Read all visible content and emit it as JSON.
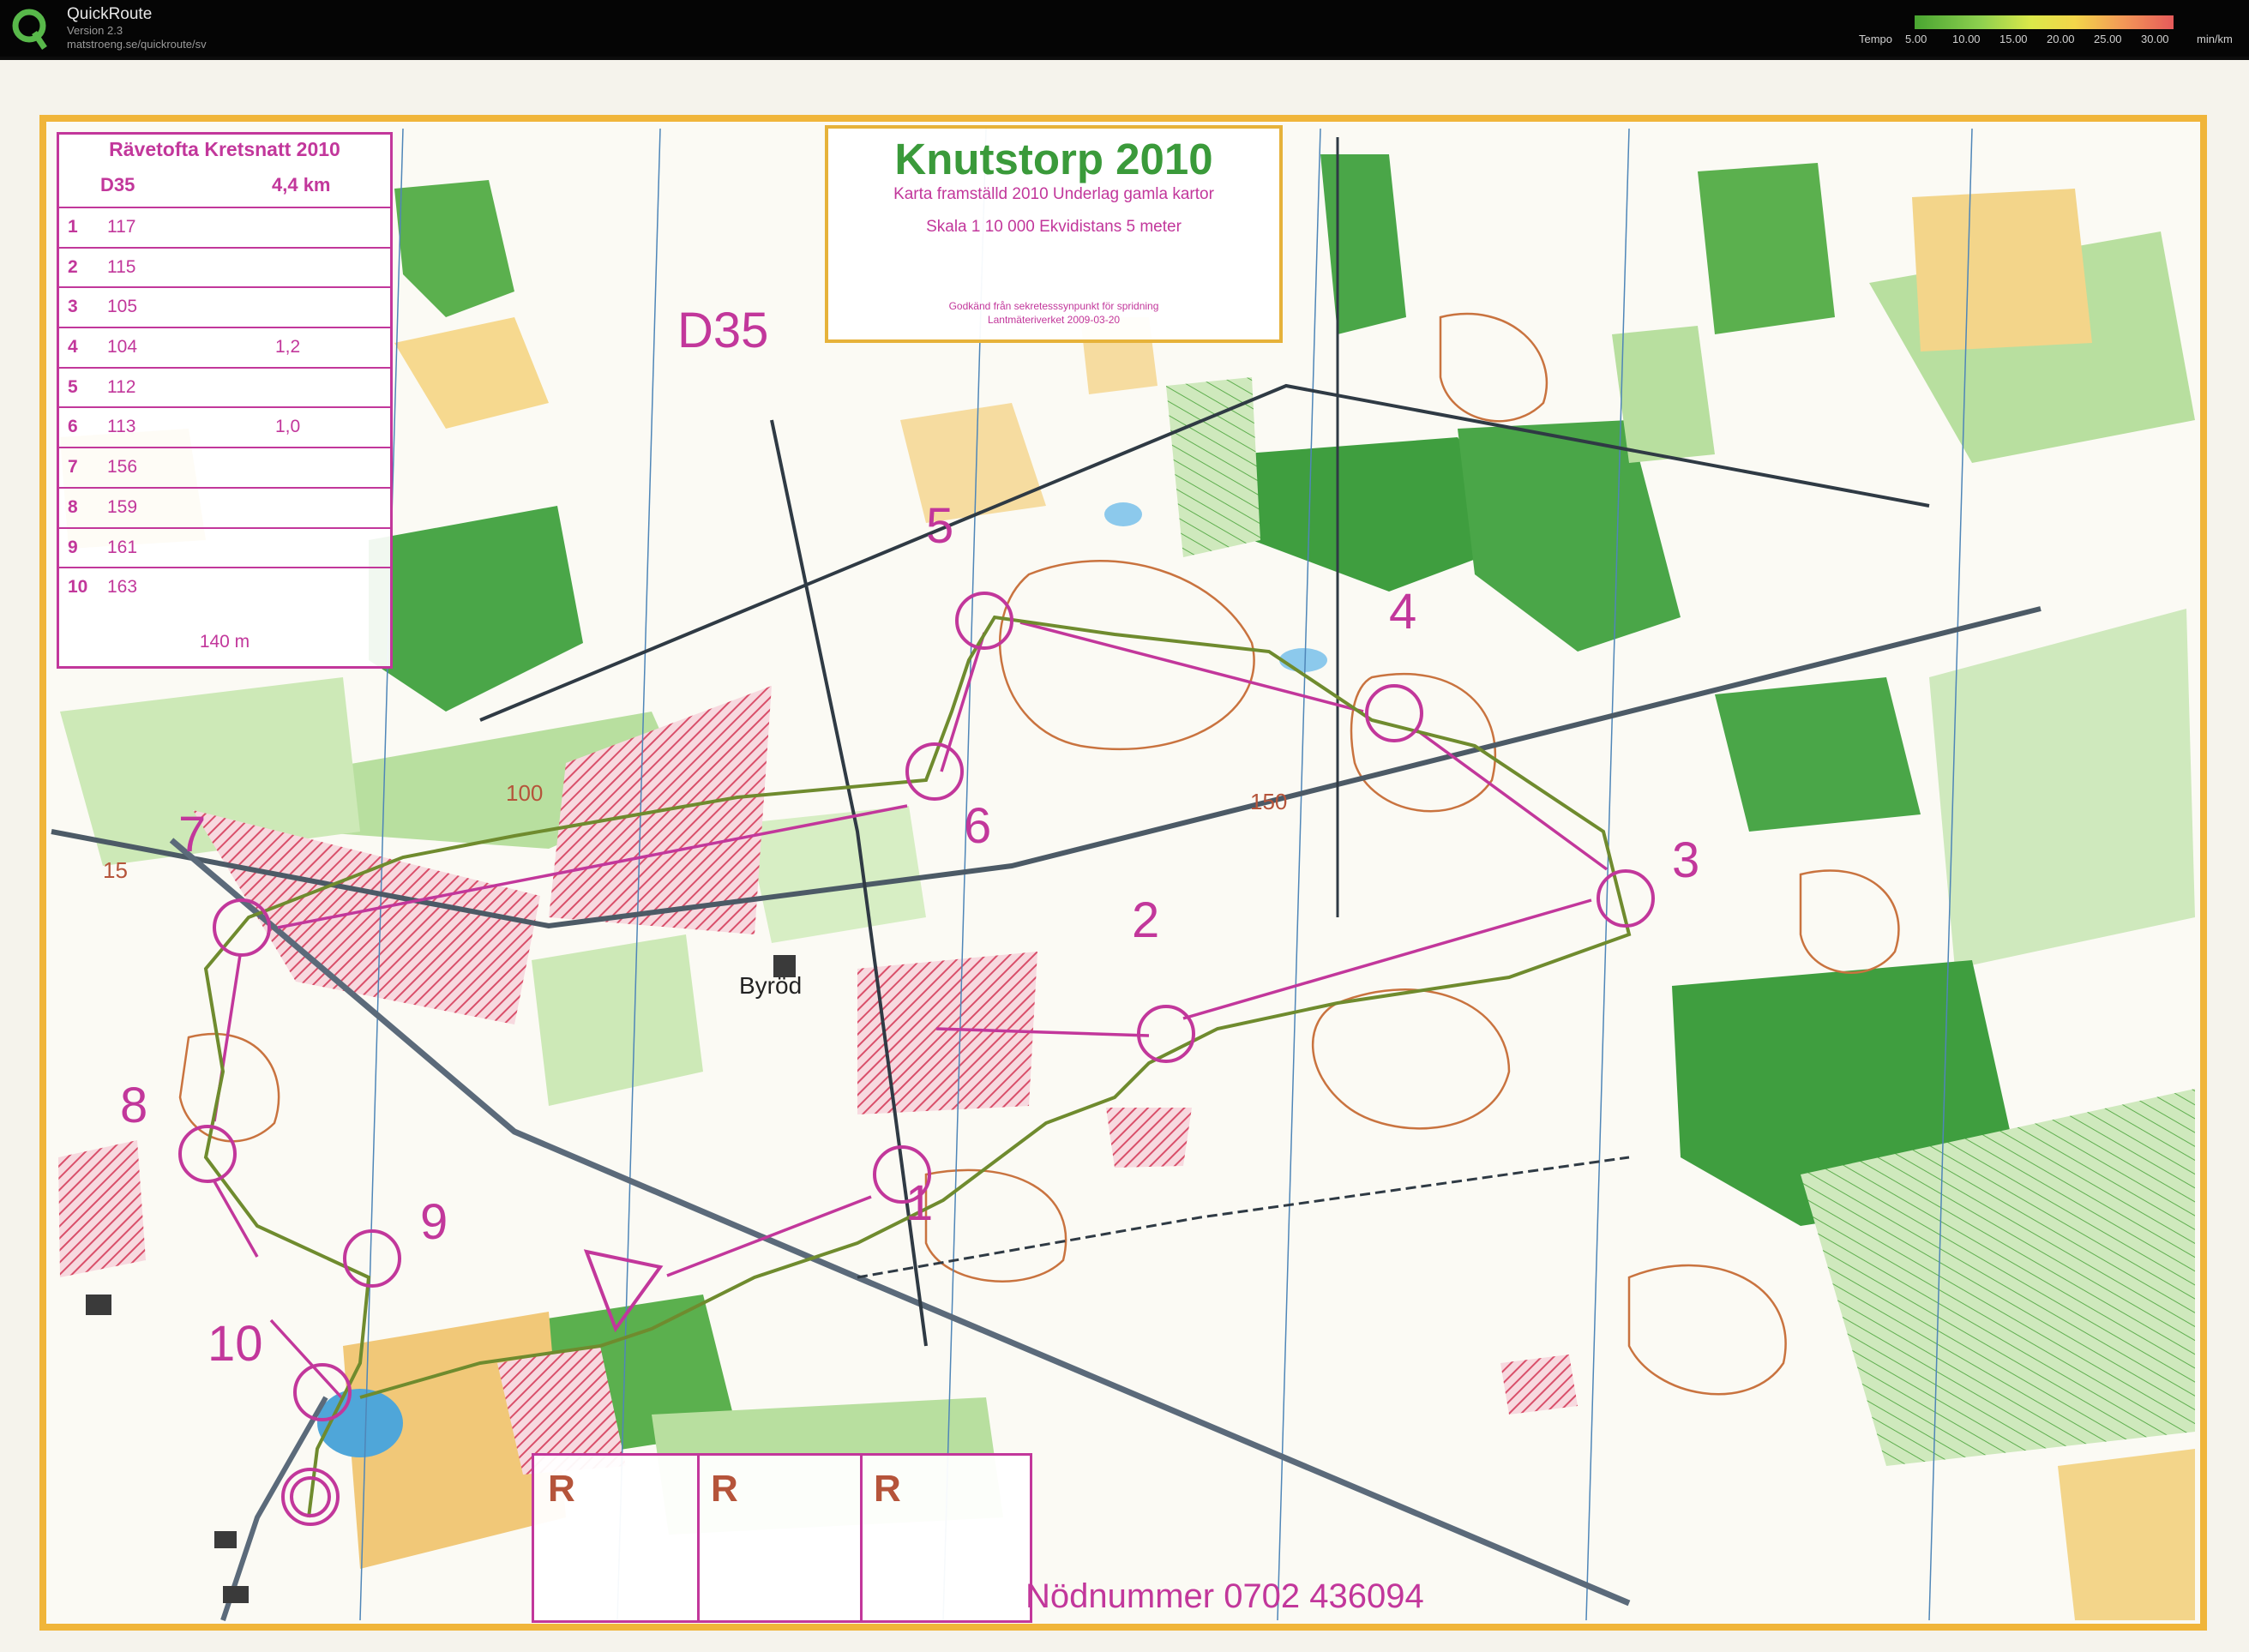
{
  "app": {
    "title": "QuickRoute",
    "version": "Version 2.3",
    "url": "matstroeng.se/quickroute/sv",
    "tempo_label": "Tempo",
    "tempo_ticks": [
      "5.00",
      "10.00",
      "15.00",
      "20.00",
      "25.00",
      "30.00"
    ],
    "tempo_unit": "min/km"
  },
  "map": {
    "title": "Knutstorp 2010",
    "subtitle_1": "Karta framställd 2010     Underlag gamla kartor",
    "subtitle_2": "Skala 1 10 000    Ekvidistans 5 meter",
    "approval_1": "Godkänd från sekretesssynpunkt för spridning",
    "approval_2": "Lantmäteriverket 2009-03-20",
    "course_label": "D35",
    "place_name": "Byröd",
    "contour_labels": [
      "100",
      "150",
      "15"
    ],
    "emergency": "Nödnummer 0702 436094",
    "r_labels": [
      "R",
      "R",
      "R"
    ]
  },
  "legend": {
    "title": "Rävetofta Kretsnatt 2010",
    "class": "D35",
    "length": "4,4 km",
    "rows": [
      {
        "num": "1",
        "code": "117",
        "dist": ""
      },
      {
        "num": "2",
        "code": "115",
        "dist": ""
      },
      {
        "num": "3",
        "code": "105",
        "dist": ""
      },
      {
        "num": "4",
        "code": "104",
        "dist": "1,2"
      },
      {
        "num": "5",
        "code": "112",
        "dist": ""
      },
      {
        "num": "6",
        "code": "113",
        "dist": "1,0"
      },
      {
        "num": "7",
        "code": "156",
        "dist": ""
      },
      {
        "num": "8",
        "code": "159",
        "dist": ""
      },
      {
        "num": "9",
        "code": "161",
        "dist": ""
      },
      {
        "num": "10",
        "code": "163",
        "dist": ""
      }
    ],
    "footer": "140 m"
  },
  "controls": [
    "1",
    "2",
    "3",
    "4",
    "5",
    "6",
    "7",
    "8",
    "9",
    "10"
  ],
  "colors": {
    "course": "#c2379b",
    "route": "#6f8b2e",
    "forest_dark": "#3f9e3f",
    "forest_light": "#b5dd9e",
    "open_land": "#f3d58a",
    "forbidden": "#d94f6a",
    "road": "#5b6a7a",
    "frame": "#f0b53a"
  }
}
